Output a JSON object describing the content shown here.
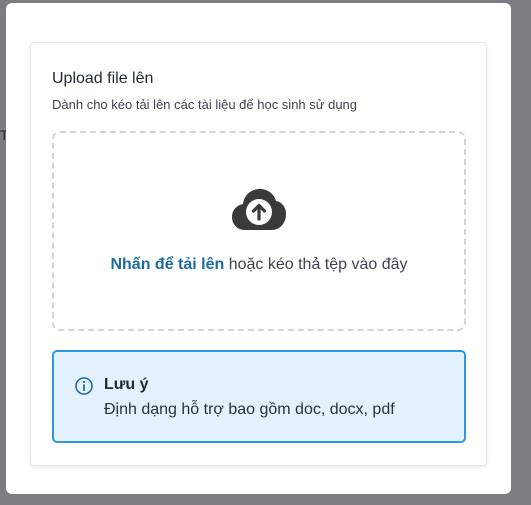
{
  "backdrop": {
    "fragment": "T"
  },
  "upload": {
    "title": "Upload file lên",
    "subtitle": "Dành cho kéo tải lên các tài liệu để học sinh sử dụng",
    "dropzone": {
      "icon": "cloud-upload-icon",
      "link_text": "Nhấn để tải lên",
      "hint_text": " hoặc kéo thả tệp vào đây"
    }
  },
  "note": {
    "icon": "info-icon",
    "title": "Lưu ý",
    "body": "Định dạng hỗ trợ bao gồm doc, docx, pdf"
  },
  "colors": {
    "link": "#1e6aa8",
    "note_border": "#2f98e3",
    "note_background": "#e3f1fc",
    "overlay": "#7b7d82",
    "icon": "#3a3a3a"
  }
}
